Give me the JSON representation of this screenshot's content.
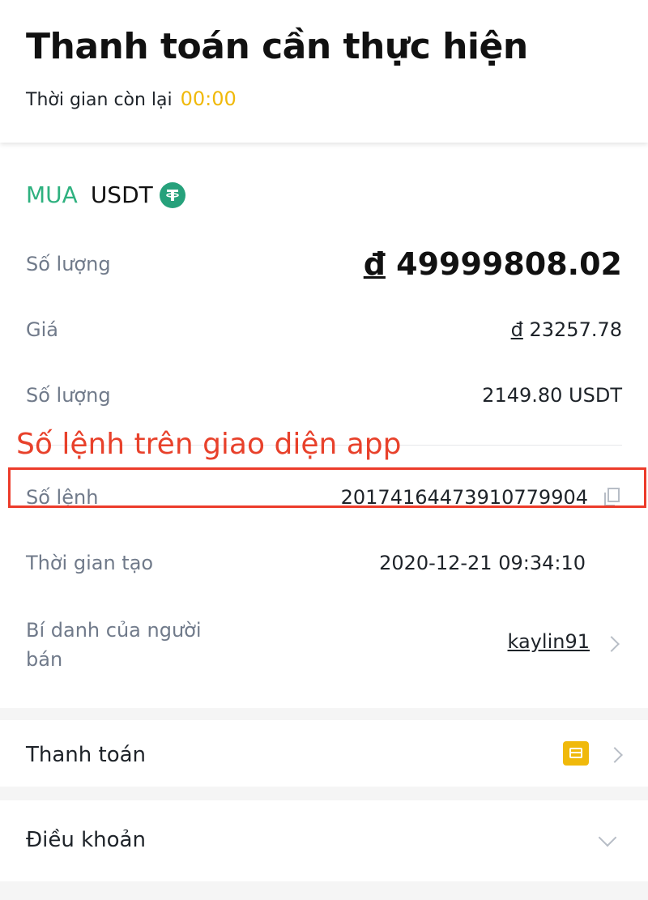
{
  "header": {
    "title": "Thanh toán cần thực hiện",
    "timer_label": "Thời gian còn lại",
    "timer_value": "00:00"
  },
  "order": {
    "side": "MUA",
    "asset": "USDT",
    "asset_icon": "tether-icon",
    "rows": {
      "amount_fiat": {
        "label": "Số lượng",
        "currency": "đ",
        "value": "49999808.02"
      },
      "price": {
        "label": "Giá",
        "currency": "đ",
        "value": "23257.78"
      },
      "amount_crypto": {
        "label": "Số lượng",
        "value": "2149.80 USDT"
      },
      "order_number": {
        "label": "Số lệnh",
        "value": "20174164473910779904"
      },
      "created_time": {
        "label": "Thời gian tạo",
        "value": "2020-12-21 09:34:10"
      },
      "seller": {
        "label": "Bí danh của người bán",
        "value": "kaylin91"
      }
    }
  },
  "annotation": {
    "text": "Số lệnh trên giao diện app",
    "color": "#e8412b"
  },
  "payment": {
    "label": "Thanh toán",
    "icon": "card-icon"
  },
  "terms": {
    "label": "Điều khoản",
    "icon": "chevron-down-icon"
  },
  "colors": {
    "accent_yellow": "#f0b90b",
    "buy_green": "#2eb17f",
    "tether_green": "#26a17b",
    "highlight_red": "#ec3b2a"
  }
}
